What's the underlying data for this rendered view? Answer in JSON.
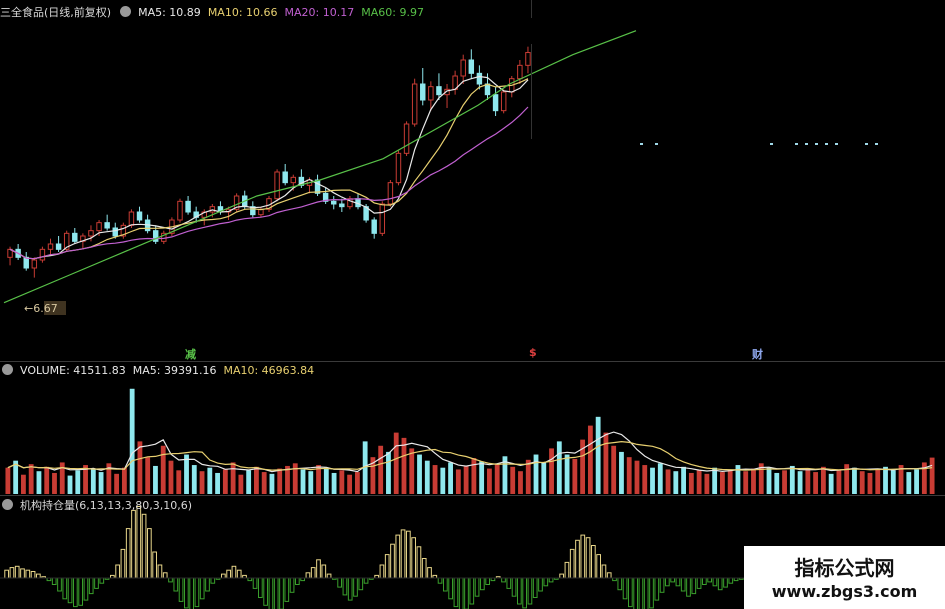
{
  "price_panel": {
    "title": "三全食品(日线,前复权)",
    "ma5": "MA5: 10.89",
    "ma10": "MA10: 10.66",
    "ma20": "MA20: 10.17",
    "ma60": "MA60: 9.97",
    "low_label": "6.67",
    "markers": [
      "减",
      "$",
      "财"
    ]
  },
  "volume_panel": {
    "title": "VOLUME: 41511.83",
    "ma5": "MA5: 39391.16",
    "ma10": "MA10: 46963.84"
  },
  "indicator_panel": {
    "title": "机构持仓量(6,13,13,3,80,3,10,6)"
  },
  "watermark": {
    "title": "指标公式网",
    "url": "www.zbgs3.com"
  },
  "colors": {
    "up": "#c83c34",
    "down": "#8fe8ee",
    "ma5": "#e8e8e8",
    "ma10": "#e8d070",
    "ma20": "#c060d0",
    "ma60": "#58c048",
    "ind_pos": "#e8d68a",
    "ind_neg": "#3aa02c"
  },
  "chart_data": [
    {
      "type": "candlestick",
      "title": "三全食品(日线,前复权)",
      "series_names": [
        "MA5",
        "MA10",
        "MA20",
        "MA60"
      ],
      "last_values": {
        "MA5": 10.89,
        "MA10": 10.66,
        "MA20": 10.17,
        "MA60": 9.97
      },
      "annotated_low": 6.67,
      "ma60_path": [
        [
          0,
          6.2
        ],
        [
          40,
          6.7
        ],
        [
          80,
          7.2
        ],
        [
          120,
          7.7
        ],
        [
          160,
          8.2
        ],
        [
          200,
          8.5
        ],
        [
          240,
          8.9
        ],
        [
          270,
          9.4
        ],
        [
          300,
          9.9
        ],
        [
          320,
          10.3
        ],
        [
          360,
          10.85
        ],
        [
          400,
          11.3
        ]
      ],
      "ohlc": [
        [
          7.05,
          7.25,
          6.9,
          7.2
        ],
        [
          7.2,
          7.3,
          7.0,
          7.05
        ],
        [
          7.05,
          7.15,
          6.8,
          6.85
        ],
        [
          6.85,
          7.05,
          6.67,
          7.0
        ],
        [
          7.0,
          7.25,
          6.95,
          7.2
        ],
        [
          7.2,
          7.4,
          7.1,
          7.3
        ],
        [
          7.3,
          7.45,
          7.15,
          7.2
        ],
        [
          7.2,
          7.55,
          7.15,
          7.5
        ],
        [
          7.5,
          7.6,
          7.3,
          7.35
        ],
        [
          7.35,
          7.5,
          7.2,
          7.45
        ],
        [
          7.45,
          7.65,
          7.35,
          7.55
        ],
        [
          7.55,
          7.75,
          7.45,
          7.7
        ],
        [
          7.7,
          7.85,
          7.55,
          7.6
        ],
        [
          7.6,
          7.7,
          7.4,
          7.45
        ],
        [
          7.45,
          7.7,
          7.4,
          7.65
        ],
        [
          7.65,
          7.95,
          7.6,
          7.9
        ],
        [
          7.9,
          8.0,
          7.7,
          7.75
        ],
        [
          7.75,
          7.85,
          7.5,
          7.55
        ],
        [
          7.55,
          7.65,
          7.3,
          7.35
        ],
        [
          7.35,
          7.55,
          7.3,
          7.5
        ],
        [
          7.5,
          7.8,
          7.45,
          7.75
        ],
        [
          7.75,
          8.15,
          7.7,
          8.1
        ],
        [
          8.1,
          8.2,
          7.85,
          7.9
        ],
        [
          7.9,
          8.0,
          7.7,
          7.8
        ],
        [
          7.8,
          7.95,
          7.65,
          7.9
        ],
        [
          7.9,
          8.05,
          7.8,
          8.0
        ],
        [
          8.0,
          8.1,
          7.85,
          7.9
        ],
        [
          7.9,
          8.0,
          7.75,
          7.95
        ],
        [
          7.95,
          8.25,
          7.9,
          8.2
        ],
        [
          8.2,
          8.3,
          7.95,
          8.0
        ],
        [
          8.0,
          8.1,
          7.8,
          7.85
        ],
        [
          7.85,
          8.0,
          7.8,
          7.95
        ],
        [
          7.95,
          8.2,
          7.9,
          8.15
        ],
        [
          8.15,
          8.7,
          8.1,
          8.65
        ],
        [
          8.65,
          8.8,
          8.4,
          8.45
        ],
        [
          8.45,
          8.6,
          8.3,
          8.55
        ],
        [
          8.55,
          8.7,
          8.35,
          8.4
        ],
        [
          8.4,
          8.55,
          8.25,
          8.5
        ],
        [
          8.5,
          8.6,
          8.2,
          8.25
        ],
        [
          8.25,
          8.35,
          8.05,
          8.1
        ],
        [
          8.1,
          8.2,
          7.95,
          8.05
        ],
        [
          8.05,
          8.15,
          7.9,
          8.0
        ],
        [
          8.0,
          8.2,
          7.95,
          8.15
        ],
        [
          8.15,
          8.25,
          7.95,
          8.0
        ],
        [
          8.0,
          8.05,
          7.7,
          7.75
        ],
        [
          7.75,
          7.8,
          7.4,
          7.5
        ],
        [
          7.5,
          8.1,
          7.45,
          8.05
        ],
        [
          8.05,
          8.5,
          8.0,
          8.45
        ],
        [
          8.45,
          9.05,
          8.4,
          9.0
        ],
        [
          9.0,
          9.6,
          8.95,
          9.55
        ],
        [
          9.55,
          10.4,
          9.5,
          10.3
        ],
        [
          10.3,
          10.6,
          9.9,
          10.0
        ],
        [
          10.0,
          10.35,
          9.8,
          10.25
        ],
        [
          10.25,
          10.5,
          10.0,
          10.1
        ],
        [
          10.1,
          10.3,
          9.85,
          10.2
        ],
        [
          10.2,
          10.55,
          10.1,
          10.45
        ],
        [
          10.45,
          10.85,
          10.3,
          10.75
        ],
        [
          10.75,
          10.95,
          10.4,
          10.5
        ],
        [
          10.5,
          10.65,
          10.2,
          10.3
        ],
        [
          10.3,
          10.5,
          10.0,
          10.1
        ],
        [
          10.1,
          10.25,
          9.7,
          9.8
        ],
        [
          9.8,
          10.2,
          9.75,
          10.15
        ],
        [
          10.15,
          10.45,
          10.05,
          10.4
        ],
        [
          10.4,
          10.75,
          10.3,
          10.65
        ],
        [
          10.65,
          11.0,
          10.5,
          10.89
        ]
      ]
    },
    {
      "type": "bar",
      "title": "VOLUME: 41511.83",
      "series_names": [
        "MA5",
        "MA10"
      ],
      "last_values": {
        "VOLUME": 41511.83,
        "MA5": 39391.16,
        "MA10": 46963.84
      },
      "values": [
        30000,
        38000,
        22000,
        34000,
        26000,
        31000,
        24000,
        36000,
        21000,
        27000,
        33000,
        29000,
        25000,
        35000,
        23000,
        30000,
        120000,
        60000,
        42000,
        32000,
        55000,
        38000,
        27000,
        45000,
        33000,
        26000,
        30000,
        24000,
        28000,
        36000,
        22000,
        27000,
        31000,
        25000,
        23000,
        29000,
        32000,
        35000,
        28000,
        26000,
        33000,
        30000,
        24000,
        27000,
        22000,
        25000,
        60000,
        42000,
        55000,
        48000,
        70000,
        64000,
        52000,
        45000,
        38000,
        33000,
        30000,
        36000,
        28000,
        32000,
        41000,
        37000,
        29000,
        34000,
        43000,
        31000,
        26000,
        39000,
        45000,
        36000,
        52000,
        60000,
        45000,
        40000,
        62000,
        78000,
        88000,
        70000,
        55000,
        48000,
        42000,
        38000,
        33000,
        30000,
        35000,
        28000,
        26000,
        31000,
        24000,
        27000,
        23000,
        30000,
        25000,
        28000,
        33000,
        26000,
        29000,
        35000,
        30000,
        24000,
        27000,
        32000,
        26000,
        29000,
        25000,
        31000,
        23000,
        28000,
        34000,
        30000,
        26000,
        24000,
        29000,
        31000,
        27000,
        33000,
        25000,
        28000,
        36000,
        41511.83
      ]
    },
    {
      "type": "bar",
      "title": "机构持仓量(6,13,13,3,80,3,10,6)",
      "values": [
        6,
        8,
        9,
        7,
        6,
        5,
        3,
        1,
        -2,
        -5,
        -10,
        -16,
        -19,
        -22,
        -21,
        -17,
        -12,
        -8,
        -4,
        -1,
        2,
        10,
        22,
        38,
        52,
        55,
        49,
        38,
        20,
        10,
        4,
        -3,
        -10,
        -18,
        -23,
        -25,
        -22,
        -16,
        -10,
        -4,
        -1,
        3,
        6,
        9,
        6,
        2,
        -2,
        -8,
        -15,
        -21,
        -26,
        -28,
        -24,
        -18,
        -11,
        -5,
        -2,
        4,
        8,
        14,
        10,
        3,
        -1,
        -7,
        -13,
        -17,
        -14,
        -9,
        -4,
        -1,
        2,
        10,
        18,
        26,
        33,
        37,
        36,
        31,
        24,
        15,
        8,
        2,
        -4,
        -10,
        -16,
        -22,
        -26,
        -24,
        -20,
        -14,
        -9,
        -5,
        -2,
        1,
        -3,
        -8,
        -14,
        -20,
        -23,
        -20,
        -15,
        -10,
        -6,
        -3,
        -1,
        3,
        12,
        22,
        29,
        33,
        31,
        25,
        18,
        10,
        4,
        -2,
        -9,
        -16,
        -22,
        -27,
        -29,
        -28,
        -23,
        -17,
        -11,
        -6,
        -3,
        -6,
        -10,
        -14,
        -12,
        -8,
        -5,
        -3,
        -6,
        -9,
        -7,
        -4,
        -2,
        -1
      ]
    }
  ]
}
